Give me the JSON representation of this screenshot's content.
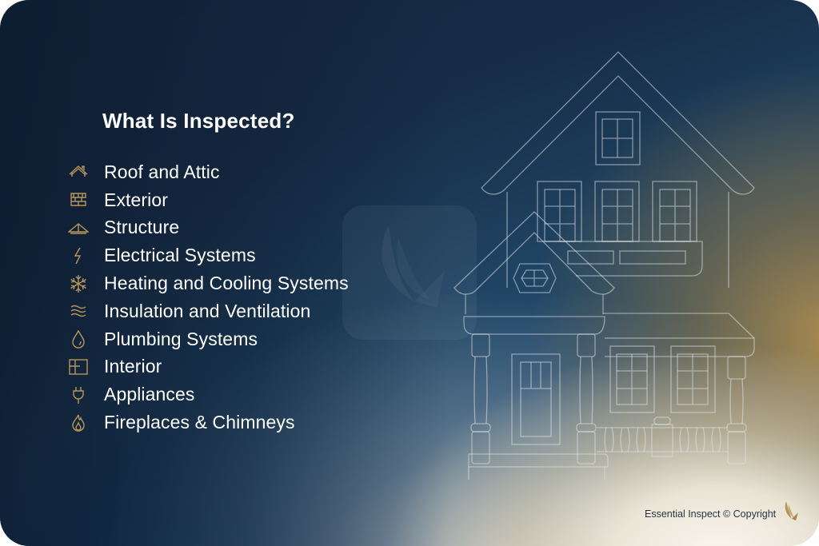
{
  "heading": "What Is Inspected?",
  "items": [
    {
      "label": "Roof and Attic",
      "icon": "roof-icon"
    },
    {
      "label": "Exterior",
      "icon": "brick-wall-icon"
    },
    {
      "label": "Structure",
      "icon": "truss-icon"
    },
    {
      "label": "Electrical Systems",
      "icon": "lightning-bolt-icon"
    },
    {
      "label": "Heating and Cooling Systems",
      "icon": "snowflake-icon"
    },
    {
      "label": "Insulation and Ventilation",
      "icon": "airflow-waves-icon"
    },
    {
      "label": "Plumbing Systems",
      "icon": "water-drop-icon"
    },
    {
      "label": "Interior",
      "icon": "floor-plan-icon"
    },
    {
      "label": "Appliances",
      "icon": "plug-icon"
    },
    {
      "label": "Fireplaces & Chimneys",
      "icon": "flame-icon"
    }
  ],
  "footer": {
    "copyright": "Essential Inspect © Copyright",
    "logo": "wing-logo-icon"
  },
  "colors": {
    "accent_gold": "#b8965a",
    "text_white": "#ffffff",
    "navy": "#13253d"
  }
}
